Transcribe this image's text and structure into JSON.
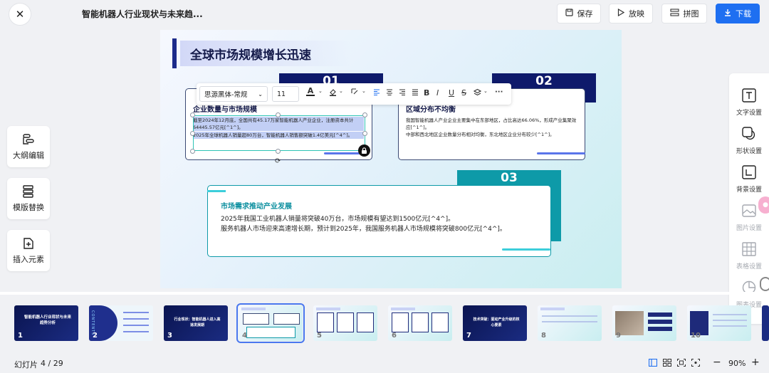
{
  "header": {
    "doc_title": "智能机器人行业现状与未来趋...",
    "save_label": "保存",
    "play_label": "放映",
    "collage_label": "拼图",
    "download_label": "下载"
  },
  "left_panel": [
    {
      "label": "大纲编辑",
      "icon": "outline-icon"
    },
    {
      "label": "模版替换",
      "icon": "template-icon"
    },
    {
      "label": "插入元素",
      "icon": "insert-element-icon"
    }
  ],
  "right_panel": [
    {
      "label": "文字设置",
      "icon": "text-settings-icon",
      "enabled": true
    },
    {
      "label": "形状设置",
      "icon": "shape-settings-icon",
      "enabled": true
    },
    {
      "label": "背景设置",
      "icon": "background-settings-icon",
      "enabled": true
    },
    {
      "label": "图片设置",
      "icon": "image-settings-icon",
      "enabled": false
    },
    {
      "label": "表格设置",
      "icon": "table-settings-icon",
      "enabled": false
    },
    {
      "label": "图表设置",
      "icon": "chart-settings-icon",
      "enabled": false
    }
  ],
  "text_toolbar": {
    "font": "思源黑体-常规",
    "size": "11",
    "font_color": "A"
  },
  "slide": {
    "title": "全球市场规模增长迅速",
    "cards": [
      {
        "number": "01",
        "heading": "企业数量与市场规模",
        "body1": "截至2024年12月底，全国共有45.17万家智能机器人产业企业，注册资本共计64445.57亿元[^1^]。",
        "body2": "2025年全球机器人销量超80万台，智能机器人销售额突破1.4亿美元[^4^]。"
      },
      {
        "number": "02",
        "heading": "区域分布不均衡",
        "body1": "我国智能机器人产业企业主要集中在东部地区，占比高达66.06%，形成产业集聚效应[^1^]。",
        "body2": "中部和西北地区企业数量分布相对均衡，东北地区企业分布较少[^1^]。"
      },
      {
        "number": "03",
        "heading": "市场需求推动产业发展",
        "body1": "2025年我国工业机器人销量将突破40万台，市场规模有望达到1500亿元[^4^]。",
        "body2": "服务机器人市场迎来高速增长期，预计到2025年，我国服务机器人市场规模将突破800亿元[^4^]。"
      }
    ]
  },
  "thumbnails": [
    {
      "num": "1",
      "title": "智能机器人行业现状与未来趋势分析"
    },
    {
      "num": "2",
      "title": "CONTENTS"
    },
    {
      "num": "3",
      "title": "行业现状：智能机器人进入高速发展期"
    },
    {
      "num": "4",
      "title": ""
    },
    {
      "num": "5",
      "title": ""
    },
    {
      "num": "6",
      "title": ""
    },
    {
      "num": "7",
      "title": "技术突破：驱动产业升级的核心要素"
    },
    {
      "num": "8",
      "title": ""
    },
    {
      "num": "9",
      "title": ""
    },
    {
      "num": "10",
      "title": ""
    }
  ],
  "statusbar": {
    "slide_label": "幻灯片",
    "slide_counter": "4 / 29",
    "zoom": "90%"
  },
  "colors": {
    "accent": "#1e6ff1",
    "navy": "#0e1a6b",
    "teal": "#0e9aa8"
  }
}
